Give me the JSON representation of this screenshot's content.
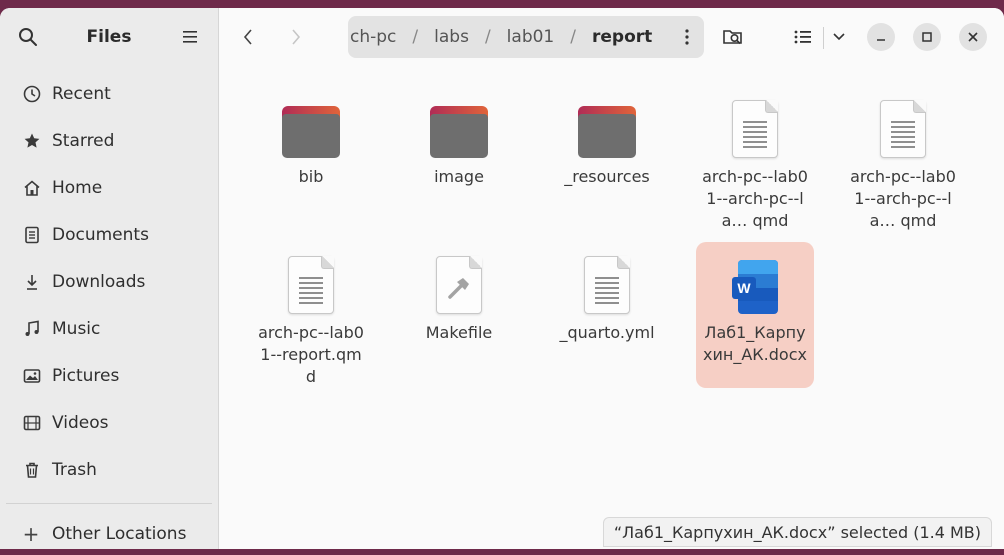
{
  "app": {
    "title": "Files"
  },
  "sidebar": {
    "items": [
      {
        "label": "Recent",
        "icon": "clock-icon"
      },
      {
        "label": "Starred",
        "icon": "star-icon"
      },
      {
        "label": "Home",
        "icon": "home-icon"
      },
      {
        "label": "Documents",
        "icon": "documents-icon"
      },
      {
        "label": "Downloads",
        "icon": "downloads-icon"
      },
      {
        "label": "Music",
        "icon": "music-icon"
      },
      {
        "label": "Pictures",
        "icon": "pictures-icon"
      },
      {
        "label": "Videos",
        "icon": "videos-icon"
      },
      {
        "label": "Trash",
        "icon": "trash-icon"
      }
    ],
    "other_locations": "Other Locations"
  },
  "pathbar": {
    "crumbs": [
      "ch-pc",
      "labs",
      "lab01",
      "report"
    ],
    "separator": "/"
  },
  "files": [
    {
      "name": "bib",
      "type": "folder"
    },
    {
      "name": "image",
      "type": "folder"
    },
    {
      "name": "_resources",
      "type": "folder"
    },
    {
      "name": "arch-pc--lab01--arch-pc--la… qmd",
      "type": "text"
    },
    {
      "name": "arch-pc--lab01--arch-pc--la… qmd",
      "type": "text"
    },
    {
      "name": "arch-pc--lab01--report.qmd",
      "type": "text"
    },
    {
      "name": "Makefile",
      "type": "makefile"
    },
    {
      "name": "_quarto.yml",
      "type": "text"
    },
    {
      "name": "Лаб1_Карпухин_АК.docx",
      "type": "word",
      "selected": true
    }
  ],
  "status": "“Лаб1_Карпухин_АК.docx” selected  (1.4 MB)",
  "colors": {
    "selection": "#f6cfc5",
    "folder_tab": "#e0643a",
    "folder_body": "#6e6e6e",
    "desktop": "#6e2a4a"
  }
}
